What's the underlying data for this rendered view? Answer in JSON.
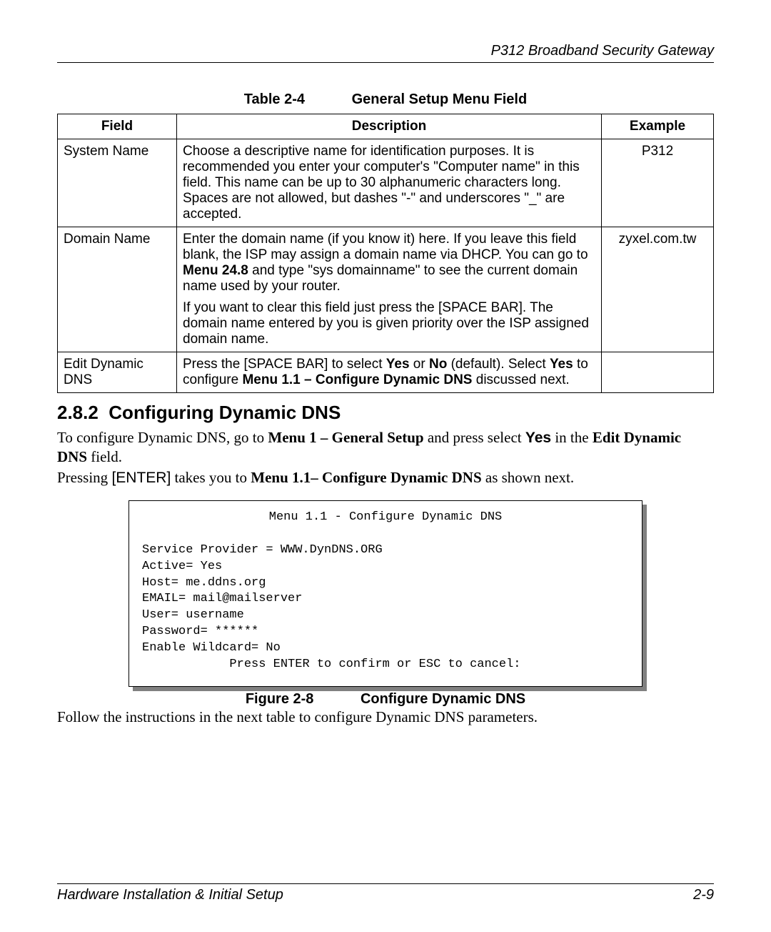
{
  "header": {
    "product": "P312  Broadband Security Gateway"
  },
  "table": {
    "number": "Table 2-4",
    "title": "General Setup Menu Field",
    "columns": {
      "field": "Field",
      "description": "Description",
      "example": "Example"
    },
    "rows": [
      {
        "field": "System Name",
        "desc_1": "Choose a descriptive name for identification purposes. It is recommended you enter your computer's \"Computer name\" in this field. This name can be up to 30 alphanumeric characters long. Spaces are not allowed, but dashes \"-\" and underscores \"_\" are accepted.",
        "example": "P312"
      },
      {
        "field": "Domain Name",
        "desc_1a": "Enter the domain name (if you know it) here. If you leave this field blank, the ISP may assign a domain name via DHCP. You can go to ",
        "desc_1b_bold": "Menu 24.8",
        "desc_1c": " and type \"sys domainname\" to see the current domain name used by your router.",
        "desc_2": "If you want to clear this field just press the [SPACE BAR]. The domain name entered by you is given priority over the ISP assigned domain name.",
        "example": "zyxel.com.tw"
      },
      {
        "field": "Edit Dynamic DNS",
        "desc_a": "Press the [SPACE BAR] to select ",
        "desc_b": "Yes",
        "desc_c": " or ",
        "desc_d": "No",
        "desc_e": " (default). Select ",
        "desc_f": "Yes",
        "desc_g": " to configure ",
        "desc_h": "Menu 1.1 – Configure Dynamic DNS",
        "desc_i": " discussed next.",
        "example": ""
      }
    ]
  },
  "section": {
    "number": "2.8.2",
    "title": "Configuring Dynamic DNS",
    "para1_a": "To configure Dynamic DNS, go to ",
    "para1_b": "Menu 1 – General Setup",
    "para1_c": " and press select ",
    "para1_d": "Yes",
    "para1_e": " in the ",
    "para1_f": "Edit Dynamic DNS",
    "para1_g": " field.",
    "para2_a": "Pressing ",
    "para2_b": "[ENTER]",
    "para2_c": " takes you to ",
    "para2_d": "Menu 1.1– Configure Dynamic DNS",
    "para2_e": " as shown next."
  },
  "console": {
    "title": "Menu 1.1 - Configure Dynamic DNS",
    "lines": {
      "service_provider": "Service Provider = WWW.DynDNS.ORG",
      "active": "Active= Yes",
      "host": "Host= me.ddns.org",
      "email": "EMAIL= mail@mailserver",
      "user": "User= username",
      "password": "Password= ******",
      "wildcard": "Enable Wildcard= No"
    },
    "prompt": "Press ENTER to confirm or ESC to cancel:"
  },
  "figure": {
    "number": "Figure 2-8",
    "title": "Configure Dynamic DNS"
  },
  "closing": "Follow the instructions in the next table to configure Dynamic DNS parameters.",
  "footer": {
    "left": "Hardware Installation & Initial Setup",
    "right": "2-9"
  }
}
